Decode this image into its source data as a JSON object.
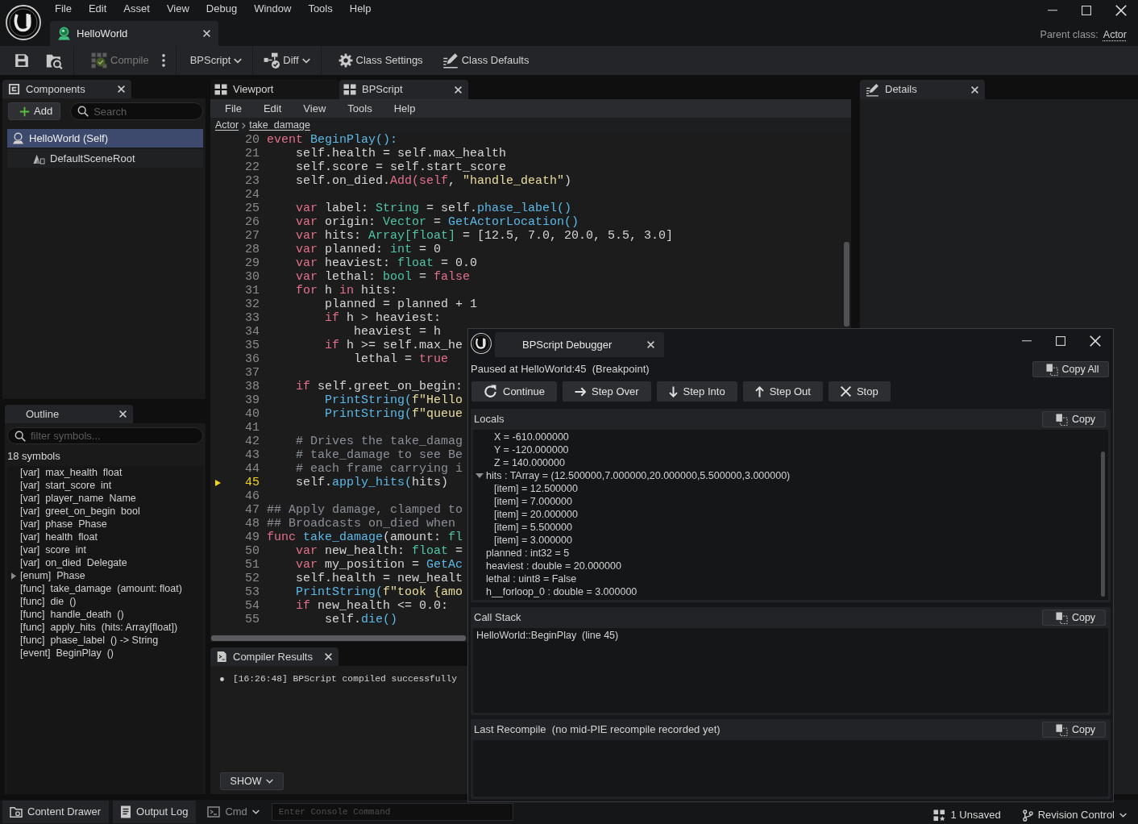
{
  "title_bar": {
    "menu": [
      "File",
      "Edit",
      "Asset",
      "View",
      "Debug",
      "Window",
      "Tools",
      "Help"
    ],
    "document_tab": {
      "label": "HelloWorld"
    },
    "parent_class": {
      "label": "Parent class:",
      "value": "Actor"
    }
  },
  "toolbar": [
    [
      {
        "kind": "save",
        "disabled": false
      },
      {
        "kind": "browse",
        "disabled": false
      }
    ],
    [
      {
        "kind": "compile",
        "label": "Compile",
        "disabled": true
      },
      {
        "kind": "more",
        "disabled": false
      }
    ],
    [
      {
        "kind": "dropdown",
        "label": "BPScript",
        "disabled": false
      }
    ],
    [
      {
        "kind": "diff",
        "label": "Diff",
        "disabled": false
      }
    ],
    [
      {
        "kind": "class_settings",
        "label": "Class Settings",
        "disabled": false
      },
      {
        "kind": "class_defaults",
        "label": "Class Defaults",
        "disabled": false
      }
    ]
  ],
  "components_panel": {
    "tab": "Components",
    "add_button": "Add",
    "search": {
      "placeholder": "Search"
    },
    "tree": [
      {
        "kind": "actor",
        "label": "HelloWorld (Self)",
        "selected": true,
        "children": [
          {
            "kind": "scene_component",
            "label": "DefaultSceneRoot",
            "selected": false
          }
        ]
      }
    ]
  },
  "outline": {
    "tab": "Outline",
    "filter": {
      "placeholder": "filter symbols..."
    },
    "count": "18 symbols",
    "items": [
      {
        "text": "[var]  max_health  float"
      },
      {
        "text": "[var]  start_score  int"
      },
      {
        "text": "[var]  player_name  Name"
      },
      {
        "text": "[var]  greet_on_begin  bool"
      },
      {
        "text": "[var]  phase  Phase"
      },
      {
        "text": "[var]  health  float"
      },
      {
        "text": "[var]  score  int"
      },
      {
        "text": "[var]  on_died  Delegate"
      },
      {
        "text": "[enum]  Phase",
        "expanded": false
      },
      {
        "text": "[func]  take_damage  (amount: float)"
      },
      {
        "text": "[func]  die  ()"
      },
      {
        "text": "[func]  handle_death  ()"
      },
      {
        "text": "[func]  apply_hits  (hits: Array[float])"
      },
      {
        "text": "[func]  phase_label  () -> String"
      },
      {
        "text": "[event]  BeginPlay  ()"
      }
    ]
  },
  "editor": {
    "tabs": [
      {
        "label": "Viewport",
        "selected": false
      },
      {
        "label": "BPScript",
        "selected": true
      }
    ],
    "menu": [
      "File",
      "Edit",
      "View",
      "Tools",
      "Help"
    ],
    "breadcrumb": [
      "Actor",
      "take_damage"
    ],
    "code": {
      "lines": [
        {
          "number": "20",
          "current": false,
          "tokens": [
            {
              "kind": "kw",
              "text": "event "
            },
            {
              "kind": "fn",
              "text": "BeginPlay():"
            }
          ]
        },
        {
          "number": "21",
          "current": false,
          "tokens": [
            {
              "kind": "plain",
              "text": "    self.health = self.max_health"
            }
          ]
        },
        {
          "number": "22",
          "current": false,
          "tokens": [
            {
              "kind": "plain",
              "text": "    self.score = self.start_score"
            }
          ]
        },
        {
          "number": "23",
          "current": false,
          "tokens": [
            {
              "kind": "plain",
              "text": "    self.on_died."
            },
            {
              "kind": "kw",
              "text": "Add(self"
            },
            {
              "kind": "plain",
              "text": ", "
            },
            {
              "kind": "str",
              "text": "\"handle_death\""
            },
            {
              "kind": "plain",
              "text": ")"
            }
          ]
        },
        {
          "number": "24",
          "current": false
        },
        {
          "number": "25",
          "current": false,
          "tokens": [
            {
              "kind": "kw",
              "text": "    var"
            },
            {
              "kind": "plain",
              "text": " label: "
            },
            {
              "kind": "type",
              "text": "String"
            },
            {
              "kind": "plain",
              "text": " = self."
            },
            {
              "kind": "fn",
              "text": "phase_label()"
            }
          ]
        },
        {
          "number": "26",
          "current": false,
          "tokens": [
            {
              "kind": "kw",
              "text": "    var"
            },
            {
              "kind": "plain",
              "text": " origin: "
            },
            {
              "kind": "type",
              "text": "Vector"
            },
            {
              "kind": "plain",
              "text": " = "
            },
            {
              "kind": "fn",
              "text": "GetActorLocation()"
            }
          ]
        },
        {
          "number": "27",
          "current": false,
          "tokens": [
            {
              "kind": "kw",
              "text": "    var"
            },
            {
              "kind": "plain",
              "text": " hits: "
            },
            {
              "kind": "type",
              "text": "Array[float]"
            },
            {
              "kind": "plain",
              "text": " = [12.5, 7.0, 20.0, 5.5, 3.0]"
            }
          ]
        },
        {
          "number": "28",
          "current": false,
          "tokens": [
            {
              "kind": "kw",
              "text": "    var"
            },
            {
              "kind": "plain",
              "text": " planned: "
            },
            {
              "kind": "type",
              "text": "int"
            },
            {
              "kind": "plain",
              "text": " = 0"
            }
          ]
        },
        {
          "number": "29",
          "current": false,
          "tokens": [
            {
              "kind": "kw",
              "text": "    var"
            },
            {
              "kind": "plain",
              "text": " heaviest: "
            },
            {
              "kind": "type",
              "text": "float"
            },
            {
              "kind": "plain",
              "text": " = 0.0"
            }
          ]
        },
        {
          "number": "30",
          "current": false,
          "tokens": [
            {
              "kind": "kw",
              "text": "    var"
            },
            {
              "kind": "plain",
              "text": " lethal: "
            },
            {
              "kind": "type",
              "text": "bool"
            },
            {
              "kind": "plain",
              "text": " = "
            },
            {
              "kind": "kw",
              "text": "false"
            }
          ]
        },
        {
          "number": "31",
          "current": false,
          "tokens": [
            {
              "kind": "kw",
              "text": "    for"
            },
            {
              "kind": "plain",
              "text": " h "
            },
            {
              "kind": "kw",
              "text": "in"
            },
            {
              "kind": "plain",
              "text": " hits:"
            }
          ]
        },
        {
          "number": "32",
          "current": false,
          "tokens": [
            {
              "kind": "plain",
              "text": "        planned = planned + 1"
            }
          ]
        },
        {
          "number": "33",
          "current": false,
          "tokens": [
            {
              "kind": "kw",
              "text": "        if"
            },
            {
              "kind": "plain",
              "text": " h > heaviest:"
            }
          ]
        },
        {
          "number": "34",
          "current": false,
          "tokens": [
            {
              "kind": "plain",
              "text": "            heaviest = h"
            }
          ]
        },
        {
          "number": "35",
          "current": false,
          "tokens": [
            {
              "kind": "kw",
              "text": "        if"
            },
            {
              "kind": "plain",
              "text": " h >= self.max_he"
            }
          ]
        },
        {
          "number": "36",
          "current": false,
          "tokens": [
            {
              "kind": "plain",
              "text": "            lethal = "
            },
            {
              "kind": "kw",
              "text": "true"
            }
          ]
        },
        {
          "number": "37",
          "current": false
        },
        {
          "number": "38",
          "current": false,
          "tokens": [
            {
              "kind": "kw",
              "text": "    if"
            },
            {
              "kind": "plain",
              "text": " self.greet_on_begin:"
            }
          ]
        },
        {
          "number": "39",
          "current": false,
          "tokens": [
            {
              "kind": "fn",
              "text": "        PrintString("
            },
            {
              "kind": "str",
              "text": "f\"Hello"
            }
          ]
        },
        {
          "number": "40",
          "current": false,
          "tokens": [
            {
              "kind": "fn",
              "text": "        PrintString("
            },
            {
              "kind": "str",
              "text": "f\"queue"
            }
          ]
        },
        {
          "number": "41",
          "current": false
        },
        {
          "number": "42",
          "current": false,
          "tokens": [
            {
              "kind": "com",
              "text": "    # Drives the take_damag"
            }
          ]
        },
        {
          "number": "43",
          "current": false,
          "tokens": [
            {
              "kind": "com",
              "text": "    # take_damage to see Be"
            }
          ]
        },
        {
          "number": "44",
          "current": false,
          "tokens": [
            {
              "kind": "com",
              "text": "    # each frame carrying i"
            }
          ]
        },
        {
          "number": "45",
          "current": true,
          "tokens": [
            {
              "kind": "plain",
              "text": "    self."
            },
            {
              "kind": "fn",
              "text": "apply_hits("
            },
            {
              "kind": "plain",
              "text": "hits)"
            }
          ]
        },
        {
          "number": "46",
          "current": false
        },
        {
          "number": "47",
          "current": false,
          "tokens": [
            {
              "kind": "com",
              "text": "## Apply damage, clamped to"
            }
          ]
        },
        {
          "number": "48",
          "current": false,
          "tokens": [
            {
              "kind": "com",
              "text": "## Broadcasts on_died when"
            }
          ]
        },
        {
          "number": "49",
          "current": false,
          "tokens": [
            {
              "kind": "kw",
              "text": "func "
            },
            {
              "kind": "fn",
              "text": "take_damage"
            },
            {
              "kind": "plain",
              "text": "(amount: "
            },
            {
              "kind": "type",
              "text": "fl"
            }
          ]
        },
        {
          "number": "50",
          "current": false,
          "tokens": [
            {
              "kind": "kw",
              "text": "    var"
            },
            {
              "kind": "plain",
              "text": " new_health: "
            },
            {
              "kind": "type",
              "text": "float"
            },
            {
              "kind": "plain",
              "text": " ="
            }
          ]
        },
        {
          "number": "51",
          "current": false,
          "tokens": [
            {
              "kind": "kw",
              "text": "    var"
            },
            {
              "kind": "plain",
              "text": " my_position = "
            },
            {
              "kind": "fn",
              "text": "GetAc"
            }
          ]
        },
        {
          "number": "52",
          "current": false,
          "tokens": [
            {
              "kind": "plain",
              "text": "    self.health = new_healt"
            }
          ]
        },
        {
          "number": "53",
          "current": false,
          "tokens": [
            {
              "kind": "fn",
              "text": "    PrintString("
            },
            {
              "kind": "str",
              "text": "f\"took {amo"
            }
          ]
        },
        {
          "number": "54",
          "current": false,
          "tokens": [
            {
              "kind": "kw",
              "text": "    if"
            },
            {
              "kind": "plain",
              "text": " new_health <= 0.0:"
            }
          ]
        },
        {
          "number": "55",
          "current": false,
          "tokens": [
            {
              "kind": "plain",
              "text": "        self."
            },
            {
              "kind": "fn",
              "text": "die()"
            }
          ]
        }
      ]
    }
  },
  "compiler_results": {
    "tab": "Compiler Results",
    "messages": [
      "[16:26:48] BPScript compiled successfully"
    ],
    "show_button": "SHOW"
  },
  "details": {
    "tab": "Details"
  },
  "debugger": {
    "tab": "BPScript Debugger",
    "status": "Paused at HelloWorld:45  (Breakpoint)",
    "copy_all": "Copy All",
    "controls": [
      {
        "kind": "continue",
        "label": "Continue"
      },
      {
        "kind": "step_over",
        "label": "Step Over"
      },
      {
        "kind": "step_into",
        "label": "Step Into"
      },
      {
        "kind": "step_out",
        "label": "Step Out"
      },
      {
        "kind": "stop",
        "label": "Stop"
      }
    ],
    "sections": [
      {
        "kind": "locals",
        "title": "Locals",
        "copy": "Copy",
        "items": [
          {
            "children": [
              {
                "text": "X = -610.000000"
              },
              {
                "text": "Y = -120.000000"
              },
              {
                "text": "Z = 140.000000"
              }
            ]
          },
          {
            "text": "hits : TArray = (12.500000,7.000000,20.000000,5.500000,3.000000)",
            "expanded": true,
            "children": [
              {
                "text": "[item] = 12.500000"
              },
              {
                "text": "[item] = 7.000000"
              },
              {
                "text": "[item] = 20.000000"
              },
              {
                "text": "[item] = 5.500000"
              },
              {
                "text": "[item] = 3.000000"
              }
            ]
          },
          {
            "text": "planned : int32 = 5"
          },
          {
            "text": "heaviest : double = 20.000000"
          },
          {
            "text": "lethal : uint8 = False"
          },
          {
            "text": "h__forloop_0 : double = 3.000000"
          }
        ]
      },
      {
        "kind": "call_stack",
        "title": "Call Stack",
        "copy": "Copy",
        "entries": [
          "HelloWorld::BeginPlay  (line 45)"
        ]
      },
      {
        "kind": "last_recompile",
        "title": "Last Recompile  (no mid-PIE recompile recorded yet)",
        "copy": "Copy"
      }
    ]
  },
  "status_bar": {
    "buttons": [
      {
        "kind": "content_drawer",
        "label": "Content Drawer"
      },
      {
        "kind": "output_log",
        "label": "Output Log"
      },
      {
        "kind": "cmd",
        "label": "Cmd"
      }
    ],
    "console": {
      "placeholder": "Enter Console Command"
    },
    "right": [
      {
        "kind": "unsaved",
        "label": "1 Unsaved"
      },
      {
        "kind": "revision_control",
        "label": "Revision Control"
      }
    ]
  }
}
